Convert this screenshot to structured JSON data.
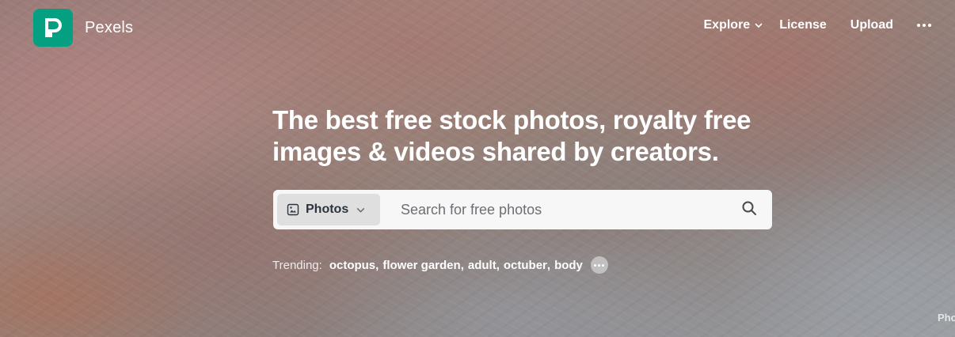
{
  "header": {
    "brand": "Pexels",
    "nav": {
      "explore": "Explore",
      "license": "License",
      "upload": "Upload"
    }
  },
  "hero": {
    "headline_line1": "The best free stock photos, royalty free",
    "headline_line2": "images & videos shared by creators."
  },
  "search": {
    "type_selected": "Photos",
    "placeholder": "Search for free photos"
  },
  "trending": {
    "label": "Trending:",
    "items": [
      "octopus",
      "flower garden",
      "adult",
      "octuber",
      "body"
    ]
  },
  "photo_credit": "Pho",
  "colors": {
    "brand": "#05a081",
    "search_bg": "#f7f7f7",
    "select_bg": "#dfdfe0",
    "text_dark": "#2c343e"
  },
  "icons": [
    "pexels-logo-icon",
    "chevron-down-icon",
    "more-horizontal-icon",
    "image-icon",
    "search-icon"
  ]
}
